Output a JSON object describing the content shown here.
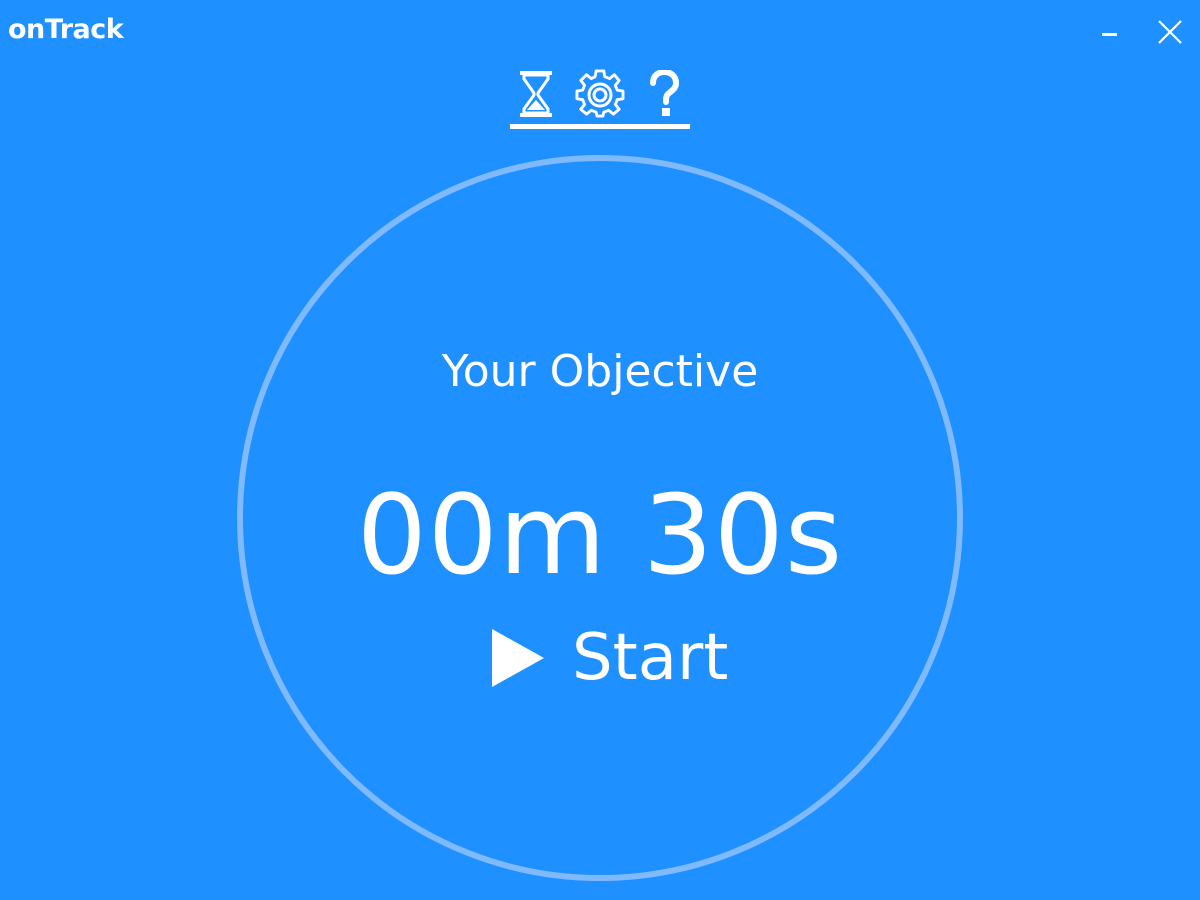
{
  "window": {
    "title": "onTrack",
    "minimize_icon": "minimize-icon",
    "close_icon": "close-icon"
  },
  "nav": {
    "tabs": [
      {
        "icon": "hourglass-icon",
        "active": true
      },
      {
        "icon": "gear-icon",
        "active": false
      },
      {
        "icon": "question-mark-icon",
        "active": false
      }
    ]
  },
  "main": {
    "objective_label": "Your Objective",
    "time": "00m 30s",
    "start_label": "Start",
    "start_icon": "play-icon"
  },
  "colors": {
    "background": "#1e90ff",
    "foreground": "#ffffff",
    "ring": "#7fbaff"
  }
}
